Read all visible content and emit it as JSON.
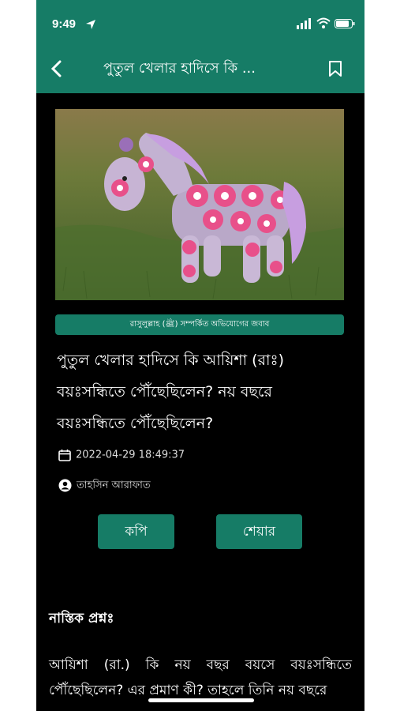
{
  "status_bar": {
    "time": "9:49"
  },
  "header": {
    "title": "পুতুল খেলার হাদিসে কি ..."
  },
  "article": {
    "category": "রাসুলুল্লাহ (ﷺ) সম্পর্কিত অভিযোগের জবাব",
    "headline": "পুতুল খেলার হাদিসে কি আয়িশা (রাঃ) বয়ঃসন্ধিতে পৌঁছেছিলেন? নয় বছরে বয়ঃসন্ধিতে পৌঁছেছিলেন?",
    "date": "2022-04-29 18:49:37",
    "author": "তাহসিন আরাফাত"
  },
  "actions": {
    "copy_label": "কপি",
    "share_label": "শেয়ার"
  },
  "content": {
    "section_title": "নাস্তিক প্রশ্নঃ",
    "paragraph": "আয়িশা (রা.) কি নয় বছর বয়সে বয়ঃসন্ধিতে পৌঁছেছিলেন? এর প্রমাণ কী? তাহলে তিনি নয় বছরে"
  },
  "colors": {
    "brand": "#167c66",
    "background": "#000000"
  },
  "icons": [
    "location-arrow-icon",
    "signal-icon",
    "wifi-icon",
    "battery-icon",
    "back-chevron-icon",
    "bookmark-icon",
    "calendar-icon",
    "user-icon"
  ]
}
